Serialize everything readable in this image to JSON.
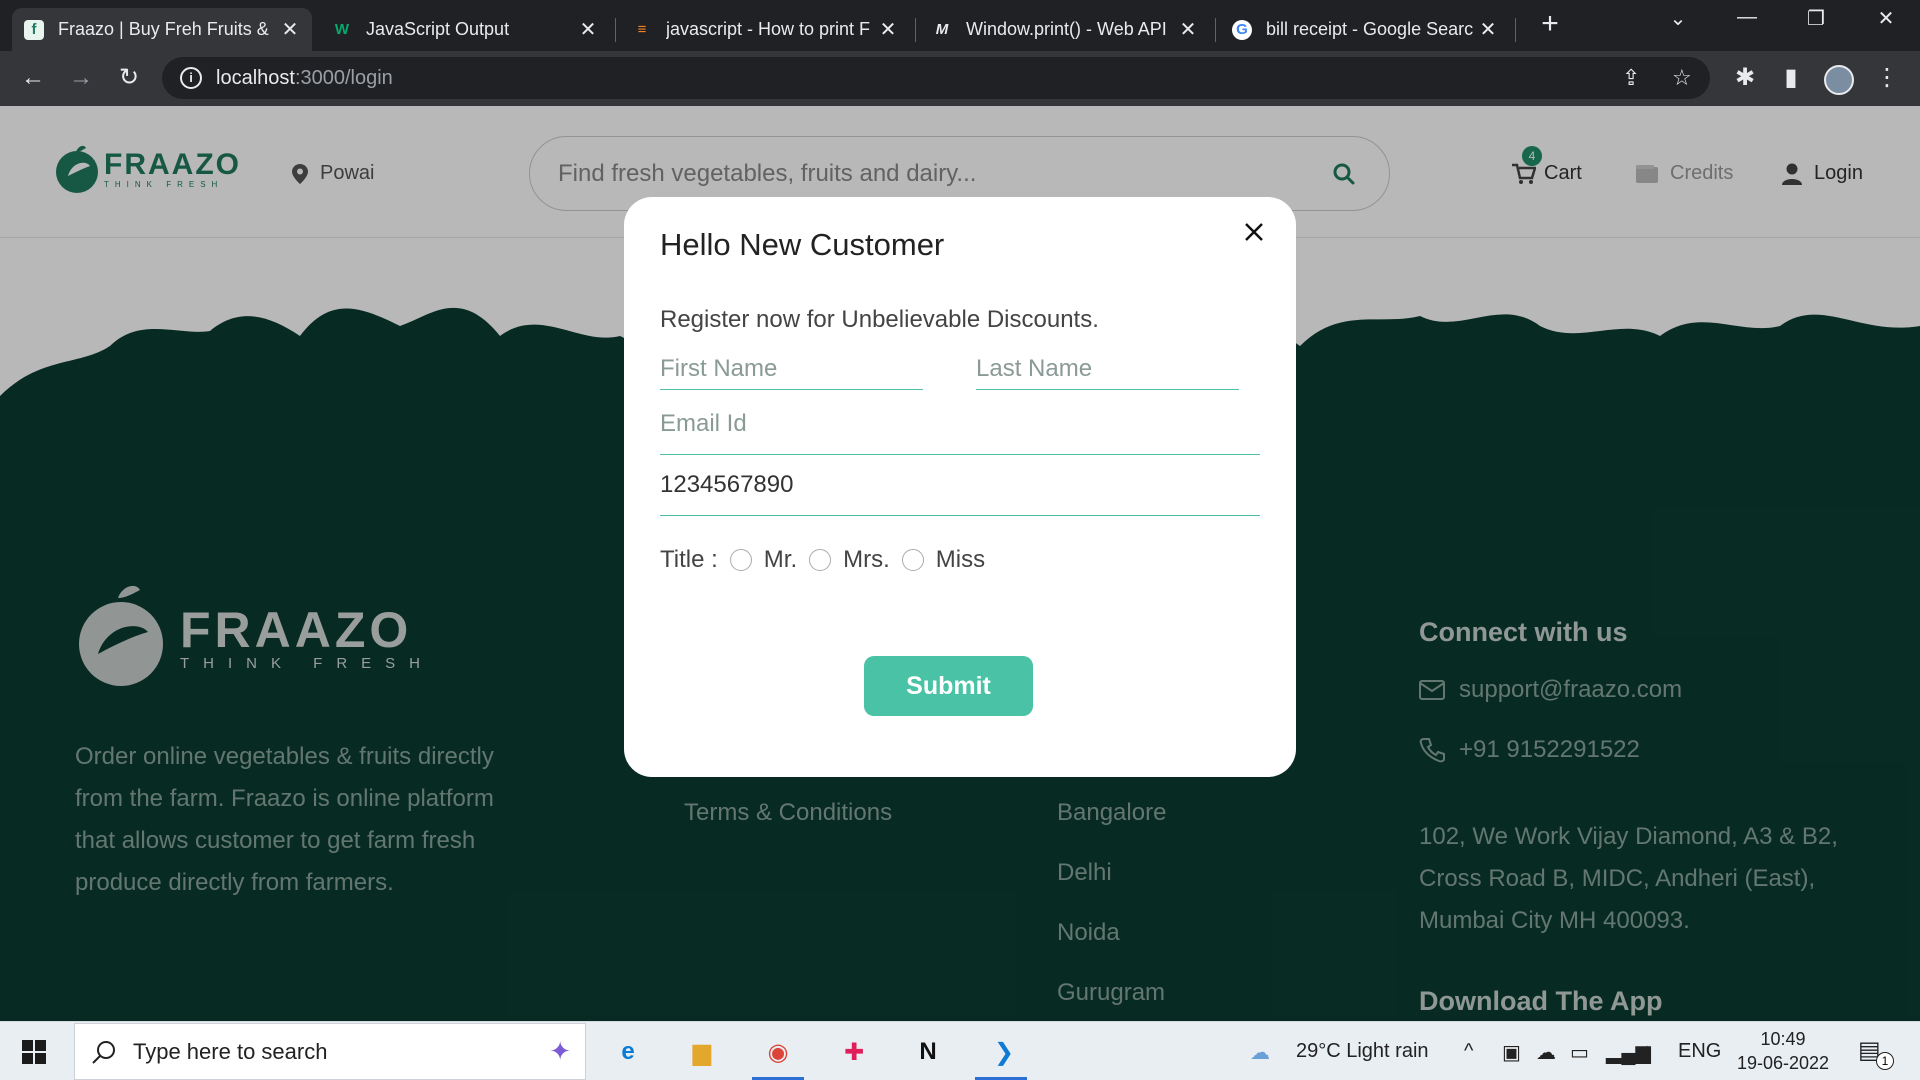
{
  "browser": {
    "tabs": [
      {
        "title": "Fraazo | Buy Freh Fruits &",
        "active": true
      },
      {
        "title": "JavaScript Output",
        "active": false
      },
      {
        "title": "javascript - How to print F",
        "active": false
      },
      {
        "title": "Window.print() - Web API",
        "active": false
      },
      {
        "title": "bill receipt - Google Searc",
        "active": false
      }
    ],
    "url_host": "localhost",
    "url_path": ":3000/login"
  },
  "header": {
    "logo_text": "FRAAZO",
    "logo_tagline": "THINK FRESH",
    "location": "Powai",
    "search_placeholder": "Find fresh vegetables, fruits and dairy...",
    "cart_label": "Cart",
    "cart_count": "4",
    "credits_label": "Credits",
    "login_label": "Login"
  },
  "footer": {
    "logo_text": "FRAAZO",
    "logo_tagline": "THINK FRESH",
    "description": "Order online vegetables & fruits directly from the farm. Fraazo is online platform that allows customer to get farm fresh produce directly from farmers.",
    "links": [
      "Terms & Conditions"
    ],
    "cities": [
      "Bangalore",
      "Delhi",
      "Noida",
      "Gurugram"
    ],
    "connect_heading": "Connect with us",
    "email": "support@fraazo.com",
    "phone": "+91 9152291522",
    "address": "102, We Work Vijay Diamond, A3 & B2, Cross Road B, MIDC, Andheri (East), Mumbai City MH 400093.",
    "download_heading": "Download The App"
  },
  "modal": {
    "title": "Hello New Customer",
    "subtitle": "Register now for Unbelievable Discounts.",
    "first_name_placeholder": "First Name",
    "last_name_placeholder": "Last Name",
    "email_placeholder": "Email Id",
    "phone_value": "1234567890",
    "title_label": "Title :",
    "title_options": [
      "Mr.",
      "Mrs.",
      "Miss"
    ],
    "submit_label": "Submit"
  },
  "taskbar": {
    "search_placeholder": "Type here to search",
    "weather": "29°C  Light rain",
    "language": "ENG",
    "time": "10:49",
    "date": "19-06-2022",
    "notification_count": "1"
  },
  "colors": {
    "brand_green": "#1f7a5f",
    "footer_bg": "#0b3b30",
    "accent_teal": "#49c2a5"
  }
}
